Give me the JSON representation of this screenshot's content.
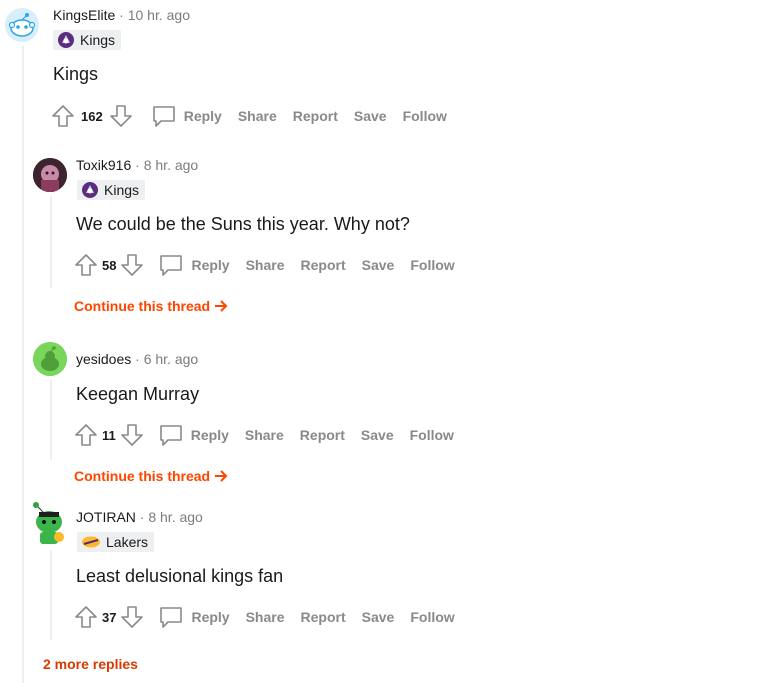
{
  "comments": [
    {
      "author": "KingsElite",
      "time": "10 hr. ago",
      "flair": "Kings",
      "text": "Kings",
      "votes": "162"
    },
    {
      "author": "Toxik916",
      "time": "8 hr. ago",
      "flair": "Kings",
      "text": "We could be the Suns this year. Why not?",
      "votes": "58"
    },
    {
      "author": "yesidoes",
      "time": "6 hr. ago",
      "text": "Keegan Murray",
      "votes": "11"
    },
    {
      "author": "JOTIRAN",
      "time": "8 hr. ago",
      "flair": "Lakers",
      "text": "Least delusional kings fan",
      "votes": "37"
    }
  ],
  "actions": {
    "reply": "Reply",
    "share": "Share",
    "report": "Report",
    "save": "Save",
    "follow": "Follow"
  },
  "separator": "·",
  "continue_thread": "Continue this thread",
  "more_replies": "2 more replies",
  "colors": {
    "accent": "#ff4500",
    "muted": "#878a8c",
    "kings_purple": "#5a2d81",
    "lakers_gold": "#fdb927"
  }
}
